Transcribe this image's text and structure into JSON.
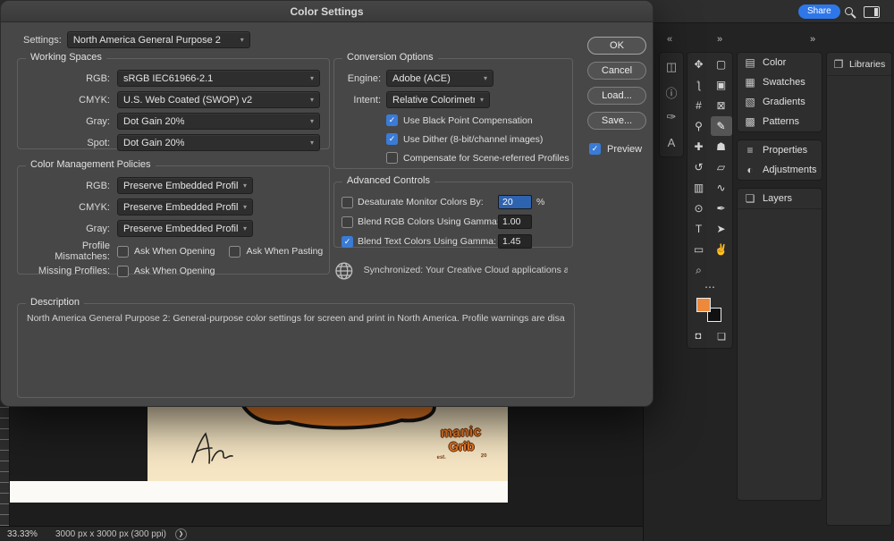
{
  "dialog": {
    "title": "Color Settings",
    "settings": {
      "label": "Settings:",
      "value": "North America General Purpose 2"
    },
    "working_spaces": {
      "title": "Working Spaces",
      "rows": [
        {
          "name": "rgb-working-space",
          "label": "RGB:",
          "value": "sRGB IEC61966-2.1"
        },
        {
          "name": "cmyk-working-space",
          "label": "CMYK:",
          "value": "U.S. Web Coated (SWOP) v2"
        },
        {
          "name": "gray-working-space",
          "label": "Gray:",
          "value": "Dot Gain 20%"
        },
        {
          "name": "spot-working-space",
          "label": "Spot:",
          "value": "Dot Gain 20%"
        }
      ]
    },
    "policies": {
      "title": "Color Management Policies",
      "rows": [
        {
          "name": "rgb-policy",
          "label": "RGB:",
          "value": "Preserve Embedded Profiles"
        },
        {
          "name": "cmyk-policy",
          "label": "CMYK:",
          "value": "Preserve Embedded Profiles"
        },
        {
          "name": "gray-policy",
          "label": "Gray:",
          "value": "Preserve Embedded Profiles"
        }
      ],
      "mismatch_label": "Profile Mismatches:",
      "mismatch_opt1": "Ask When Opening",
      "mismatch_opt2": "Ask When Pasting",
      "missing_label": "Missing Profiles:",
      "missing_opt1": "Ask When Opening"
    },
    "conversion": {
      "title": "Conversion Options",
      "engine_label": "Engine:",
      "engine_value": "Adobe (ACE)",
      "intent_label": "Intent:",
      "intent_value": "Relative Colorimetric",
      "opts": [
        {
          "name": "black-point-compensation",
          "label": "Use Black Point Compensation",
          "checked": true
        },
        {
          "name": "use-dither",
          "label": "Use Dither (8-bit/channel images)",
          "checked": true
        },
        {
          "name": "scene-referred-profiles",
          "label": "Compensate for Scene-referred Profiles",
          "checked": false
        }
      ]
    },
    "advanced": {
      "title": "Advanced Controls",
      "rows": [
        {
          "name": "desaturate-monitor",
          "label": "Desaturate Monitor Colors By:",
          "value": "20",
          "suffix": "%",
          "checked": false,
          "selected": true
        },
        {
          "name": "blend-rgb-gamma",
          "label": "Blend RGB Colors Using Gamma:",
          "value": "1.00",
          "checked": false
        },
        {
          "name": "blend-text-gamma",
          "label": "Blend Text Colors Using Gamma:",
          "value": "1.45",
          "checked": true
        }
      ]
    },
    "sync_text": "Synchronized: Your Creative Cloud applications are…",
    "buttons": {
      "ok": "OK",
      "cancel": "Cancel",
      "load": "Load...",
      "save": "Save...",
      "preview": "Preview"
    },
    "description": {
      "title": "Description",
      "text": "North America General Purpose 2:  General-purpose color settings for screen and print in North America. Profile warnings are disabled."
    }
  },
  "topbar": {
    "share": "Share"
  },
  "dock_icons": [
    {
      "name": "histogram-icon",
      "glyph": "◫"
    },
    {
      "name": "info-icon",
      "glyph": "ⓘ"
    },
    {
      "name": "brush-settings-icon",
      "glyph": "✑"
    },
    {
      "name": "character-icon",
      "glyph": "A"
    }
  ],
  "toolbar": {
    "tools": [
      {
        "name": "move-tool",
        "glyph": "✥"
      },
      {
        "name": "rectangular-marquee-tool",
        "glyph": "▢"
      },
      {
        "name": "lasso-tool",
        "glyph": "ƪ"
      },
      {
        "name": "object-selection-tool",
        "glyph": "▣"
      },
      {
        "name": "crop-tool",
        "glyph": "#"
      },
      {
        "name": "frame-tool",
        "glyph": "⊠"
      },
      {
        "name": "eyedropper-tool",
        "glyph": "⚲"
      },
      {
        "name": "brush-tool",
        "glyph": "✎",
        "selected": true
      },
      {
        "name": "healing-brush-tool",
        "glyph": "✚"
      },
      {
        "name": "clone-stamp-tool",
        "glyph": "☗"
      },
      {
        "name": "history-brush-tool",
        "glyph": "↺"
      },
      {
        "name": "eraser-tool",
        "glyph": "▱"
      },
      {
        "name": "gradient-tool",
        "glyph": "▥"
      },
      {
        "name": "blur-tool",
        "glyph": "∿"
      },
      {
        "name": "dodge-tool",
        "glyph": "⊙"
      },
      {
        "name": "pen-tool",
        "glyph": "✒"
      },
      {
        "name": "type-tool",
        "glyph": "T"
      },
      {
        "name": "path-selection-tool",
        "glyph": "➤"
      },
      {
        "name": "rectangle-tool",
        "glyph": "▭"
      },
      {
        "name": "hand-tool",
        "glyph": "✌"
      },
      {
        "name": "zoom-tool",
        "glyph": "⌕"
      }
    ]
  },
  "panel_groups": [
    {
      "items": [
        {
          "label": "Color",
          "icon": "color-icon",
          "glyph": "▤"
        },
        {
          "label": "Swatches",
          "icon": "swatches-icon",
          "glyph": "▦"
        },
        {
          "label": "Gradients",
          "icon": "gradients-icon",
          "glyph": "▧"
        },
        {
          "label": "Patterns",
          "icon": "patterns-icon",
          "glyph": "▩"
        }
      ]
    },
    {
      "items": [
        {
          "label": "Properties",
          "icon": "properties-icon",
          "glyph": "≡"
        },
        {
          "label": "Adjustments",
          "icon": "adjustments-icon",
          "glyph": "◐"
        }
      ]
    }
  ],
  "layers": {
    "label": "Layers"
  },
  "libraries": {
    "label": "Libraries"
  },
  "status": {
    "zoom": "33.33%",
    "dims": "3000 px x 3000 px (300 ppi)"
  },
  "canvas": {
    "word1": "manic",
    "word2": "Grib",
    "sub1": "est.",
    "sub2": "20"
  },
  "icons": {
    "dropdown_caret": "▾",
    "check": "✓",
    "collapse_left": "«",
    "collapse_right": "»",
    "more": "⋯",
    "status_chevron": "❯",
    "quickmask": "◘",
    "screenmode": "❏",
    "layers": "❏",
    "libraries": "❐"
  },
  "colors": {
    "accent_checkbox": "#3a7bd5",
    "selection_blue": "#2e63b0",
    "share_blue": "#2f77e8",
    "foreground_swatch": "#ee8a3c",
    "background_swatch": "#111111",
    "canvas_cream": "#f6e6c4",
    "artwork_orange": "#ee7f28"
  }
}
